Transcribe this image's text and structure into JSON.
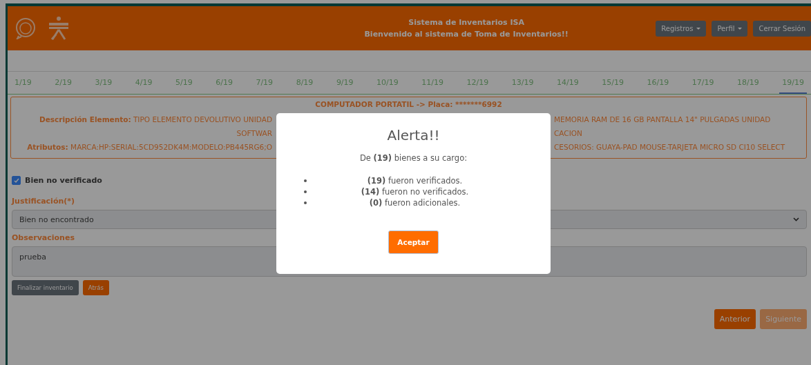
{
  "header": {
    "title": "Sistema de Inventarios ISA",
    "subtitle": "Bienvenido al sistema de Toma de Inventarios!!",
    "menu": [
      {
        "label": "Registros",
        "kind": "dropdown"
      },
      {
        "label": "Perfil",
        "kind": "dropdown"
      },
      {
        "label": "Cerrar Sesión",
        "kind": "plain"
      }
    ]
  },
  "pagination": [
    {
      "label": "1/19",
      "selected": false
    },
    {
      "label": "2/19",
      "selected": false
    },
    {
      "label": "3/19",
      "selected": false
    },
    {
      "label": "4/19",
      "selected": false
    },
    {
      "label": "5/19",
      "selected": false
    },
    {
      "label": "6/19",
      "selected": false
    },
    {
      "label": "7/19",
      "selected": false
    },
    {
      "label": "8/19",
      "selected": false
    },
    {
      "label": "9/19",
      "selected": false
    },
    {
      "label": "10/19",
      "selected": false
    },
    {
      "label": "11/19",
      "selected": false
    },
    {
      "label": "12/19",
      "selected": false
    },
    {
      "label": "13/19",
      "selected": false
    },
    {
      "label": "14/19",
      "selected": false
    },
    {
      "label": "15/19",
      "selected": false
    },
    {
      "label": "16/19",
      "selected": false
    },
    {
      "label": "17/19",
      "selected": false
    },
    {
      "label": "18/19",
      "selected": false
    },
    {
      "label": "19/19",
      "selected": true
    }
  ],
  "item_card": {
    "title": "COMPUTADOR PORTATIL -> Placa: *******6992",
    "rows": [
      {
        "left": "**Descripción Elemento:** TIPO ELEMENTO DEVOLUTIVO UNIDAD",
        "right": "MEMORIA RAM DE 16 GB PANTALLA 14\" PULGADAS UNIDAD"
      },
      {
        "left": "SOFTWAR",
        "right": "CACION"
      },
      {
        "left": "**Atributos:** MARCA:HP:SERIAL:5CD952DK4M:MODELO:PB445RG6;O",
        "right": "CESORIOS: GUAYA-PAD MOUSE-TARJETA MICRO SD CI10 SELECT"
      }
    ]
  },
  "not_verified": {
    "label": "Bien no verificado",
    "checked": true
  },
  "justification": {
    "label": "Justificación(*)",
    "value": "Bien no encontrado"
  },
  "observations": {
    "label": "Observaciones",
    "value": "prueba"
  },
  "form_buttons": [
    {
      "label": "Finalizar inventario",
      "kind": "dark"
    },
    {
      "label": "Atrás",
      "kind": "orange"
    }
  ],
  "nav_buttons": [
    {
      "label": "Anterior",
      "disabled": false
    },
    {
      "label": "Siguiente",
      "disabled": true
    }
  ],
  "modal": {
    "title": "Alerta!!",
    "intro": "De **(19)** bienes a su cargo:",
    "items": [
      "**(19)** fueron verificados.",
      "**(14)** fueron no verificados.",
      "**(0)** fueron adicionales."
    ],
    "button": "Aceptar"
  }
}
